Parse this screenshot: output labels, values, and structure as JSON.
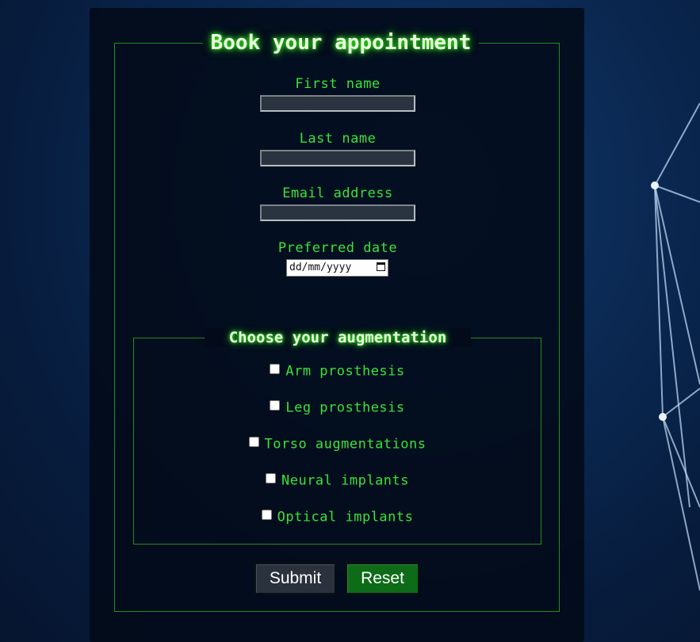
{
  "form": {
    "title": "Book your appointment",
    "fields": [
      {
        "label": "First name",
        "value": ""
      },
      {
        "label": "Last name",
        "value": ""
      },
      {
        "label": "Email address",
        "value": ""
      }
    ],
    "date_field": {
      "label": "Preferred date",
      "placeholder": "dd/mm/yyyy"
    },
    "augmentation": {
      "legend": "Choose your augmentation",
      "options": [
        {
          "label": "Arm prosthesis",
          "checked": false
        },
        {
          "label": "Leg prosthesis",
          "checked": false
        },
        {
          "label": "Torso augmentations",
          "checked": false
        },
        {
          "label": "Neural implants",
          "checked": false
        },
        {
          "label": "Optical implants",
          "checked": false
        }
      ]
    },
    "buttons": {
      "submit_label": "Submit",
      "reset_label": "Reset"
    }
  },
  "colors": {
    "accent_green": "#38e438",
    "reset_button": "#0e6b18",
    "submit_button": "#2a323d",
    "background": "#0b2a55"
  },
  "icons": {
    "date_picker": "calendar-icon"
  }
}
